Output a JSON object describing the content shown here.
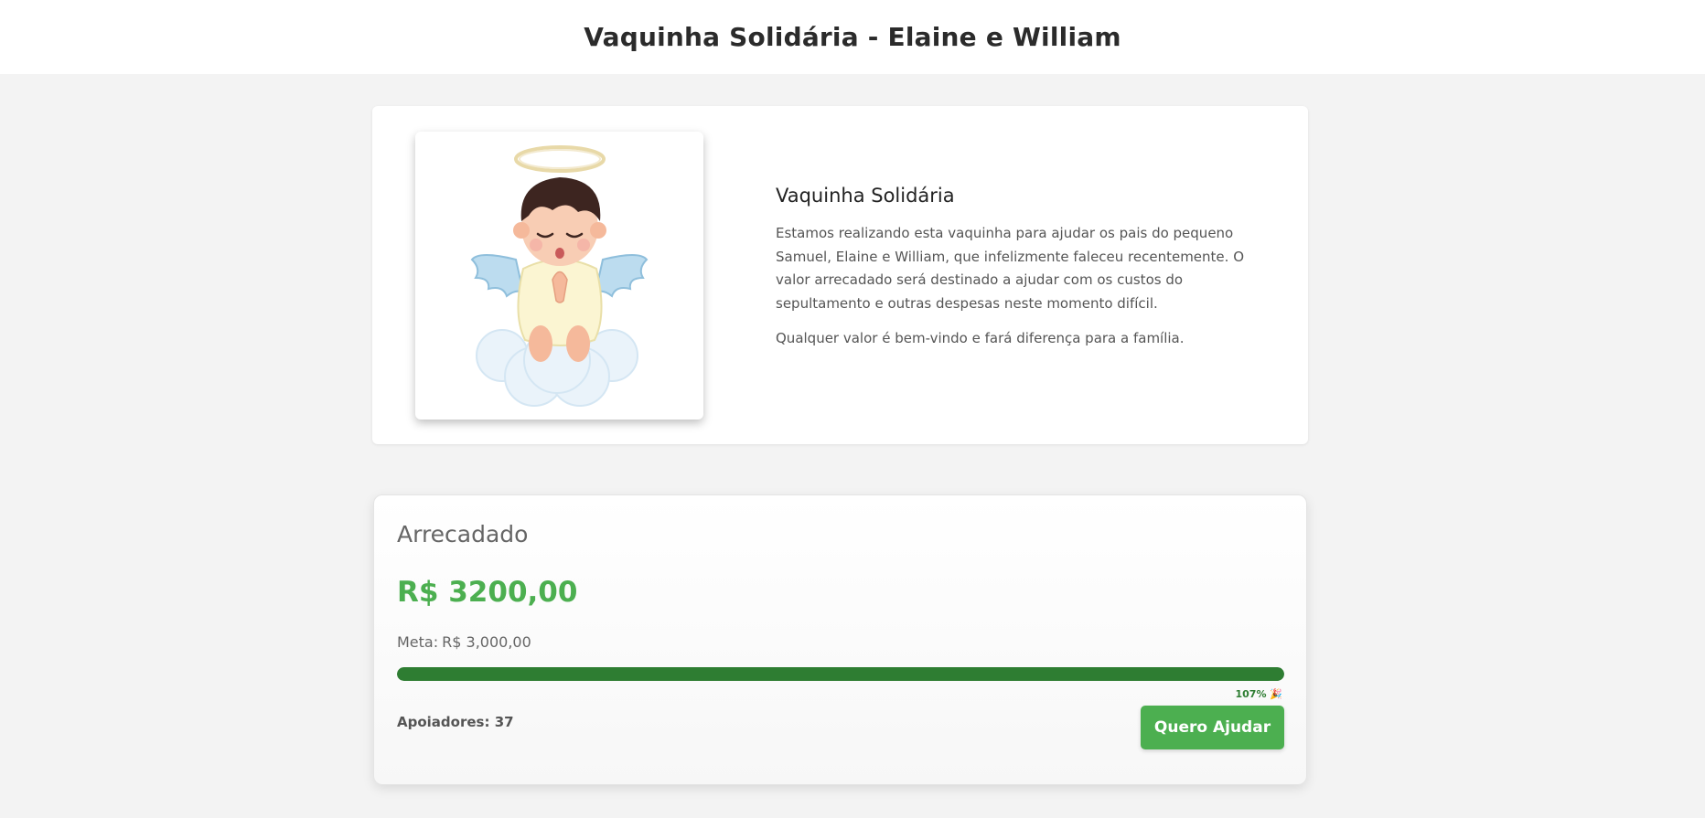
{
  "header": {
    "title": "Vaquinha Solidária - Elaine e William"
  },
  "intro": {
    "heading": "Vaquinha Solidária",
    "paragraph1": "Estamos realizando esta vaquinha para ajudar os pais do pequeno Samuel, Elaine e William, que infelizmente faleceu recentemente. O valor arrecadado será destinado a ajudar com os custos do sepultamento e outras despesas neste momento difícil.",
    "paragraph2": "Qualquer valor é bem-vindo e fará diferença para a família.",
    "image_icon": "angel-baby-illustration"
  },
  "funds": {
    "title": "Arrecadado",
    "amount": "R$ 3200,00",
    "goal_label": "Meta:",
    "goal_value": "R$ 3,000,00",
    "progress_percent": 107,
    "progress_label": "107% 🎉",
    "supporters_label": "Apoiadores:",
    "supporters_count": "37",
    "help_button_label": "Quero Ajudar"
  },
  "colors": {
    "accent_green": "#4caf50",
    "progress_green": "#2e7d32",
    "page_background": "#f3f3f3"
  }
}
